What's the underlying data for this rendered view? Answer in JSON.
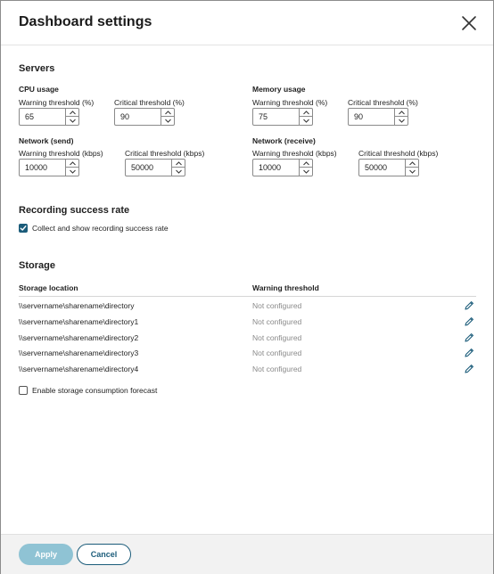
{
  "dialog": {
    "title": "Dashboard settings",
    "close_icon": "close-icon"
  },
  "servers": {
    "title": "Servers",
    "cpu": {
      "label": "CPU usage",
      "warning_label": "Warning threshold (%)",
      "warning_value": "65",
      "critical_label": "Critical threshold (%)",
      "critical_value": "90"
    },
    "memory": {
      "label": "Memory usage",
      "warning_label": "Warning threshold (%)",
      "warning_value": "75",
      "critical_label": "Critical threshold (%)",
      "critical_value": "90"
    },
    "network_send": {
      "label": "Network (send)",
      "warning_label": "Warning threshold (kbps)",
      "warning_value": "10000",
      "critical_label": "Critical threshold (kbps)",
      "critical_value": "50000"
    },
    "network_receive": {
      "label": "Network (receive)",
      "warning_label": "Warning threshold (kbps)",
      "warning_value": "10000",
      "critical_label": "Critical threshold (kbps)",
      "critical_value": "50000"
    }
  },
  "recording": {
    "title": "Recording success rate",
    "checkbox_label": "Collect and show recording success rate",
    "checked": true
  },
  "storage": {
    "title": "Storage",
    "col_location": "Storage location",
    "col_threshold": "Warning threshold",
    "rows": [
      {
        "location": "\\\\servername\\sharename\\directory",
        "threshold": "Not configured"
      },
      {
        "location": "\\\\servername\\sharename\\directory1",
        "threshold": "Not configured"
      },
      {
        "location": "\\\\servername\\sharename\\directory2",
        "threshold": "Not configured"
      },
      {
        "location": "\\\\servername\\sharename\\directory3",
        "threshold": "Not configured"
      },
      {
        "location": "\\\\servername\\sharename\\directory4",
        "threshold": "Not configured"
      }
    ],
    "forecast_label": "Enable storage consumption forecast",
    "forecast_checked": false
  },
  "footer": {
    "apply_label": "Apply",
    "cancel_label": "Cancel"
  },
  "colors": {
    "accent": "#1b5c7a",
    "apply_disabled_bg": "#8fc3d4",
    "muted_text": "#8a8a8a"
  }
}
